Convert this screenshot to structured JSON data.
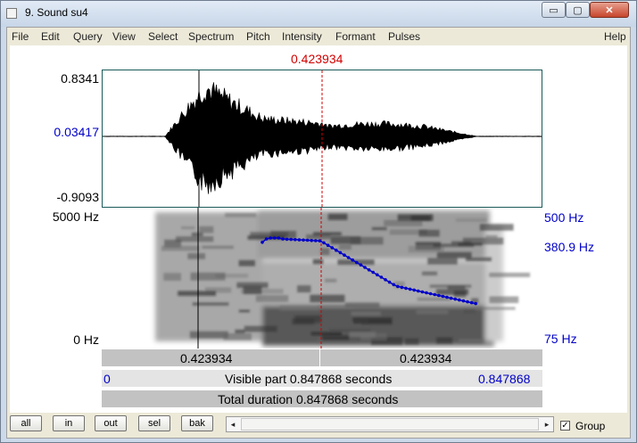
{
  "window": {
    "title": "9. Sound su4"
  },
  "window_controls": {
    "minimize": "▭",
    "maximize": "▢",
    "close": "✕"
  },
  "menu": [
    "File",
    "Edit",
    "Query",
    "View",
    "Select",
    "Spectrum",
    "Pitch",
    "Intensity",
    "Formant",
    "Pulses",
    "Help"
  ],
  "editor": {
    "cursor_time": "0.423934",
    "waveform": {
      "max_label": "0.8341",
      "mid_label": "0.03417",
      "min_label": "-0.9093"
    },
    "spectrogram": {
      "top_label": "5000 Hz",
      "bottom_label": "0 Hz"
    },
    "pitch": {
      "top_label": "500 Hz",
      "cursor_label": "380.9 Hz",
      "bottom_label": "75 Hz"
    },
    "selection_row": {
      "left": "0.423934",
      "right": "0.423934"
    },
    "visible_row": {
      "start": "0",
      "text": "Visible part 0.847868 seconds",
      "end": "0.847868"
    },
    "total_row": {
      "text": "Total duration 0.847868 seconds"
    }
  },
  "bottom": {
    "buttons": [
      "all",
      "in",
      "out",
      "sel",
      "bak"
    ],
    "scroll_left": "◂",
    "scroll_right": "▸",
    "group_label": "Group",
    "group_checked": "✓"
  },
  "colors": {
    "cursor": "#d40000",
    "pitch": "#0000c8",
    "frame": "#1a5a5a"
  }
}
